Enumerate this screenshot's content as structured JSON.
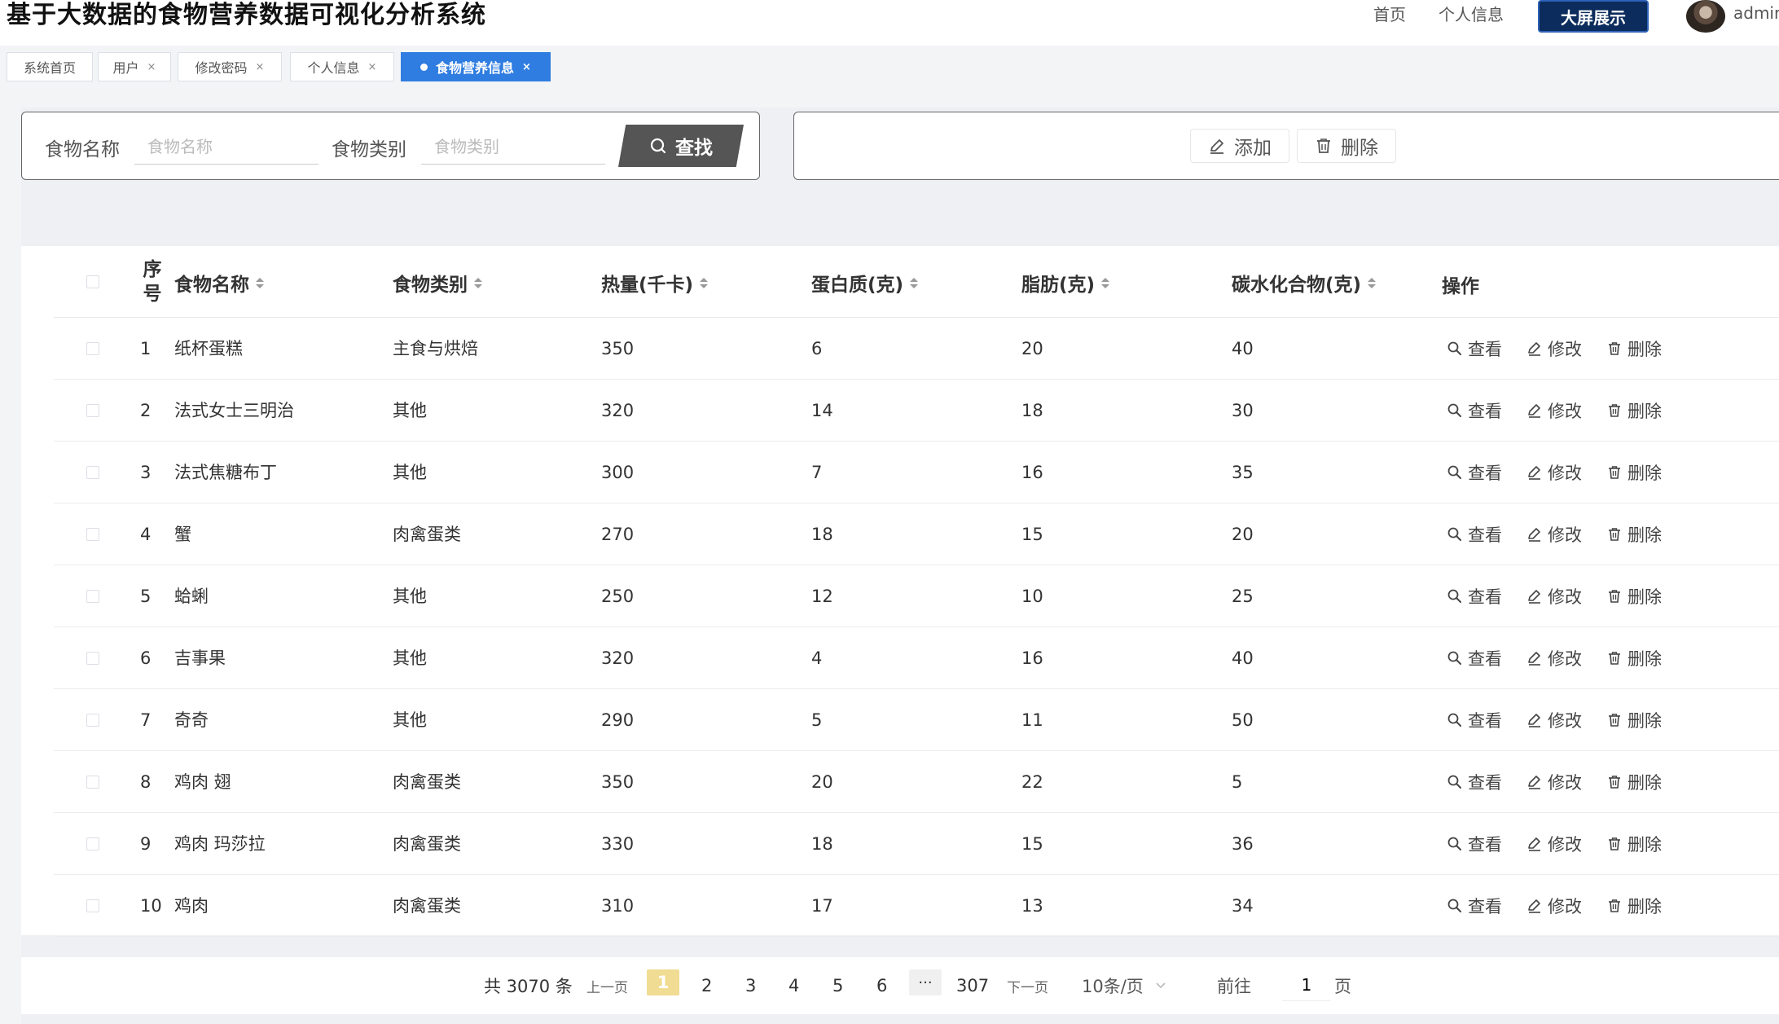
{
  "header": {
    "title": "基于大数据的食物营养数据可视化分析系统",
    "nav": [
      "首页",
      "个人信息"
    ],
    "big_screen_label": "大屏展示",
    "username": "admin"
  },
  "tabs": [
    {
      "label": "系统首页",
      "active": false,
      "closable": false
    },
    {
      "label": "用户",
      "active": false,
      "closable": true
    },
    {
      "label": "修改密码",
      "active": false,
      "closable": true
    },
    {
      "label": "个人信息",
      "active": false,
      "closable": true
    },
    {
      "label": "食物营养信息",
      "active": true,
      "closable": true
    }
  ],
  "close_glyph": "×",
  "search": {
    "name_label": "食物名称",
    "name_placeholder": "食物名称",
    "category_label": "食物类别",
    "category_placeholder": "食物类别",
    "button_label": "查找"
  },
  "actions": {
    "add_label": "添加",
    "delete_label": "删除"
  },
  "table": {
    "headers": {
      "index": "序号",
      "name": "食物名称",
      "category": "食物类别",
      "calories": "热量(千卡)",
      "protein": "蛋白质(克)",
      "fat": "脂肪(克)",
      "carbs": "碳水化合物(克)",
      "ops": "操作"
    },
    "rows": [
      {
        "index": "1",
        "name": "纸杯蛋糕",
        "category": "主食与烘焙",
        "calories": "350",
        "protein": "6",
        "fat": "20",
        "carbs": "40"
      },
      {
        "index": "2",
        "name": "法式女士三明治",
        "category": "其他",
        "calories": "320",
        "protein": "14",
        "fat": "18",
        "carbs": "30"
      },
      {
        "index": "3",
        "name": "法式焦糖布丁",
        "category": "其他",
        "calories": "300",
        "protein": "7",
        "fat": "16",
        "carbs": "35"
      },
      {
        "index": "4",
        "name": "蟹",
        "category": "肉禽蛋类",
        "calories": "270",
        "protein": "18",
        "fat": "15",
        "carbs": "20"
      },
      {
        "index": "5",
        "name": "蛤蜊",
        "category": "其他",
        "calories": "250",
        "protein": "12",
        "fat": "10",
        "carbs": "25"
      },
      {
        "index": "6",
        "name": "吉事果",
        "category": "其他",
        "calories": "320",
        "protein": "4",
        "fat": "16",
        "carbs": "40"
      },
      {
        "index": "7",
        "name": "奇奇",
        "category": "其他",
        "calories": "290",
        "protein": "5",
        "fat": "11",
        "carbs": "50"
      },
      {
        "index": "8",
        "name": "鸡肉 翅",
        "category": "肉禽蛋类",
        "calories": "350",
        "protein": "20",
        "fat": "22",
        "carbs": "5"
      },
      {
        "index": "9",
        "name": "鸡肉 玛莎拉",
        "category": "肉禽蛋类",
        "calories": "330",
        "protein": "18",
        "fat": "15",
        "carbs": "36"
      },
      {
        "index": "10",
        "name": "鸡肉",
        "category": "肉禽蛋类",
        "calories": "310",
        "protein": "17",
        "fat": "13",
        "carbs": "34"
      }
    ],
    "row_ops": {
      "view": "查看",
      "edit": "修改",
      "delete": "删除"
    }
  },
  "pagination": {
    "total_text": "共 3070 条",
    "prev": "上一页",
    "pages": [
      "1",
      "2",
      "3",
      "4",
      "5",
      "6"
    ],
    "current": "1",
    "ellipsis": "···",
    "last": "307",
    "next": "下一页",
    "page_size": "10条/页",
    "goto_label": "前往",
    "goto_value": "1",
    "page_unit": "页"
  },
  "colors": {
    "active_tab": "#2f7de1",
    "big_screen_button": "#0b2c5c",
    "search_button": "#555555",
    "current_page": "#f0dc92"
  }
}
